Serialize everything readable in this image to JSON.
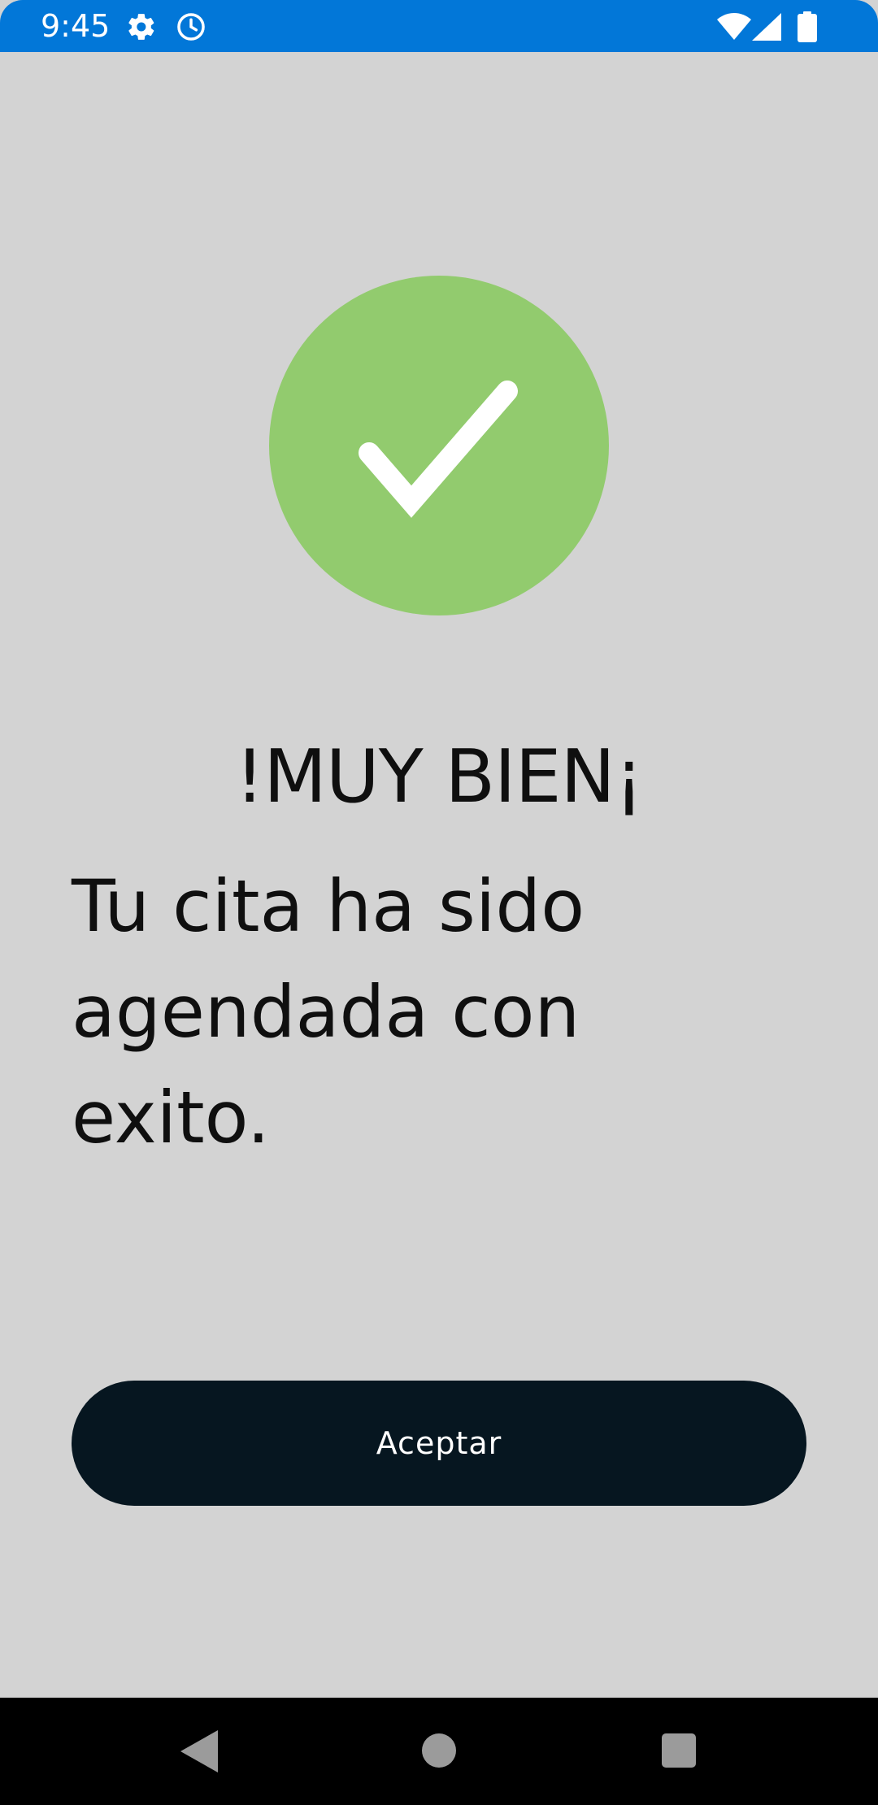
{
  "status_bar": {
    "time": "9:45",
    "icons": [
      "gear-icon",
      "clock-icon",
      "wifi-icon",
      "signal-icon",
      "battery-icon"
    ],
    "color": "#0277d8"
  },
  "success": {
    "icon": "check-icon",
    "circle_color": "#92cb6e"
  },
  "content": {
    "headline": "!MUY BIEN¡",
    "message": "Tu cita ha sido\n agendada con\nexito."
  },
  "actions": {
    "accept_label": "Aceptar",
    "accept_color": "#061620"
  },
  "navigation": {
    "icons": [
      "back-icon",
      "home-icon",
      "recents-icon"
    ]
  }
}
